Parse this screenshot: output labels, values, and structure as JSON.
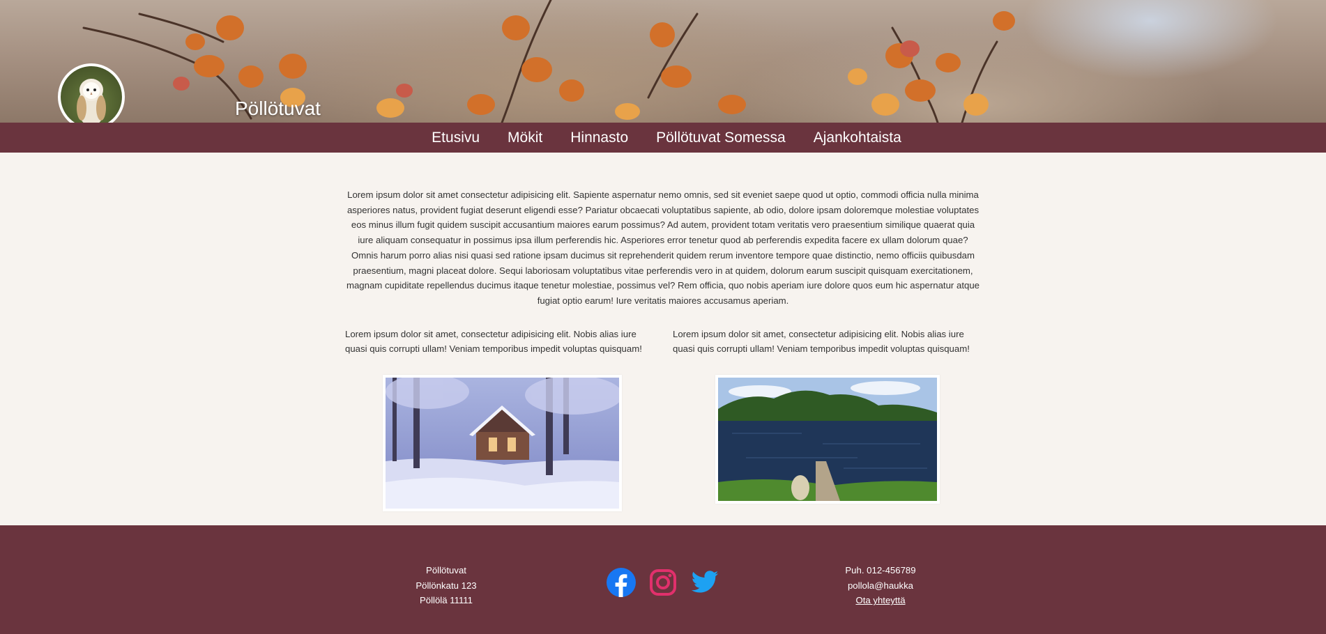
{
  "header": {
    "site_title": "Pöllötuvat"
  },
  "nav": {
    "items": [
      "Etusivu",
      "Mökit",
      "Hinnasto",
      "Pöllötuvat Somessa",
      "Ajankohtaista"
    ]
  },
  "main": {
    "intro": "Lorem ipsum dolor sit amet consectetur adipisicing elit. Sapiente aspernatur nemo omnis, sed sit eveniet saepe quod ut optio, commodi officia nulla minima asperiores natus, provident fugiat deserunt eligendi esse? Pariatur obcaecati voluptatibus sapiente, ab odio, dolore ipsam doloremque molestiae voluptates eos minus illum fugit quidem suscipit accusantium maiores earum possimus? Ad autem, provident totam veritatis vero praesentium similique quaerat quia iure aliquam consequatur in possimus ipsa illum perferendis hic. Asperiores error tenetur quod ab perferendis expedita facere ex ullam dolorum quae? Omnis harum porro alias nisi quasi sed ratione ipsam ducimus sit reprehenderit quidem rerum inventore tempore quae distinctio, nemo officiis quibusdam praesentium, magni placeat dolore. Sequi laboriosam voluptatibus vitae perferendis vero in at quidem, dolorum earum suscipit quisquam exercitationem, magnam cupiditate repellendus ducimus itaque tenetur molestiae, possimus vel? Rem officia, quo nobis aperiam iure dolore quos eum hic aspernatur atque fugiat optio earum! Iure veritatis maiores accusamus aperiam.",
    "col_left": "Lorem ipsum dolor sit amet, consectetur adipisicing elit. Nobis alias iure quasi quis corrupti ullam! Veniam temporibus impedit voluptas quisquam!",
    "col_right": "Lorem ipsum dolor sit amet, consectetur adipisicing elit. Nobis alias iure quasi quis corrupti ullam! Veniam temporibus impedit voluptas quisquam!"
  },
  "footer": {
    "name": "Pöllötuvat",
    "street": "Pöllönkatu 123",
    "city": "Pöllölä 11111",
    "phone": "Puh. 012-456789",
    "email": "pollola@haukka",
    "contact_link": "Ota yhteyttä",
    "social_icons": [
      "facebook-icon",
      "instagram-icon",
      "twitter-icon"
    ]
  },
  "colors": {
    "brand": "#6a343e",
    "background": "#f7f3ef",
    "facebook": "#1877f2",
    "instagram": "#e1306c",
    "twitter": "#1da1f2"
  }
}
